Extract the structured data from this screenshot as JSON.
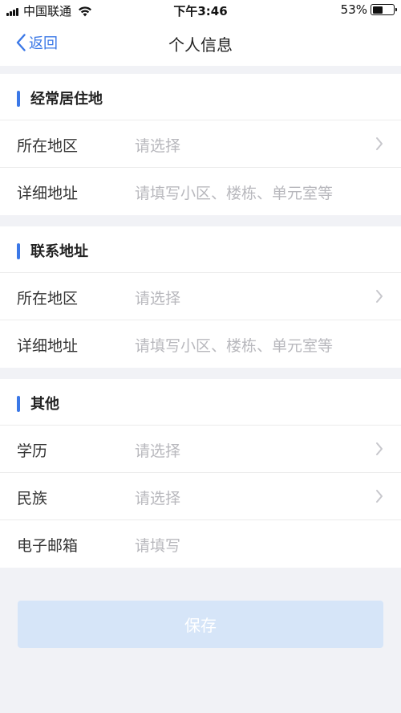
{
  "status_bar": {
    "carrier": "中国联通",
    "time": "下午3:46",
    "battery_percent": "53%",
    "battery_level": 0.53
  },
  "nav": {
    "back_label": "返回",
    "title": "个人信息"
  },
  "sections": [
    {
      "title": "经常居住地",
      "rows": [
        {
          "label": "所在地区",
          "value": "请选择",
          "chevron": true
        },
        {
          "label": "详细地址",
          "value": "请填写小区、楼栋、单元室等",
          "chevron": false
        }
      ]
    },
    {
      "title": "联系地址",
      "rows": [
        {
          "label": "所在地区",
          "value": "请选择",
          "chevron": true
        },
        {
          "label": "详细地址",
          "value": "请填写小区、楼栋、单元室等",
          "chevron": false
        }
      ]
    },
    {
      "title": "其他",
      "rows": [
        {
          "label": "学历",
          "value": "请选择",
          "chevron": true
        },
        {
          "label": "民族",
          "value": "请选择",
          "chevron": true
        },
        {
          "label": "电子邮箱",
          "value": "请填写",
          "chevron": false
        }
      ]
    }
  ],
  "save_label": "保存",
  "colors": {
    "accent": "#3b78e7",
    "save_button_bg": "#d6e5f8",
    "placeholder": "#b8b8bd"
  }
}
